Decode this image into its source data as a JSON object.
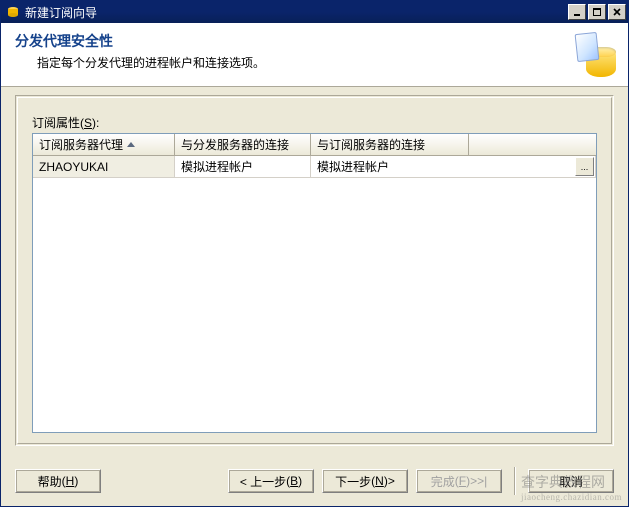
{
  "window": {
    "title": "新建订阅向导"
  },
  "header": {
    "title": "分发代理安全性",
    "subtitle": "指定每个分发代理的进程帐户和连接选项。"
  },
  "grid": {
    "label_prefix": "订阅属性(",
    "label_hotkey": "S",
    "label_suffix": "):",
    "columns": {
      "c0": "订阅服务器代理",
      "c1": "与分发服务器的连接",
      "c2": "与订阅服务器的连接"
    },
    "rows": [
      {
        "agent": "ZHAOYUKAI",
        "distributor": "模拟进程帐户",
        "subscriber": "模拟进程帐户"
      }
    ],
    "browse_label": "..."
  },
  "footer": {
    "help": {
      "label": "帮助",
      "hotkey": "H"
    },
    "back": {
      "label": "< 上一步",
      "hotkey": "B"
    },
    "next": {
      "label": "下一步",
      "hotkey": "N",
      "suffix": " >"
    },
    "finish": {
      "label": "完成",
      "hotkey": "F",
      "suffix": " >>|"
    },
    "cancel": {
      "label": "取消"
    }
  },
  "watermark": {
    "line1": "查字典教程网",
    "line2": "jiaocheng.chazidian.com"
  }
}
